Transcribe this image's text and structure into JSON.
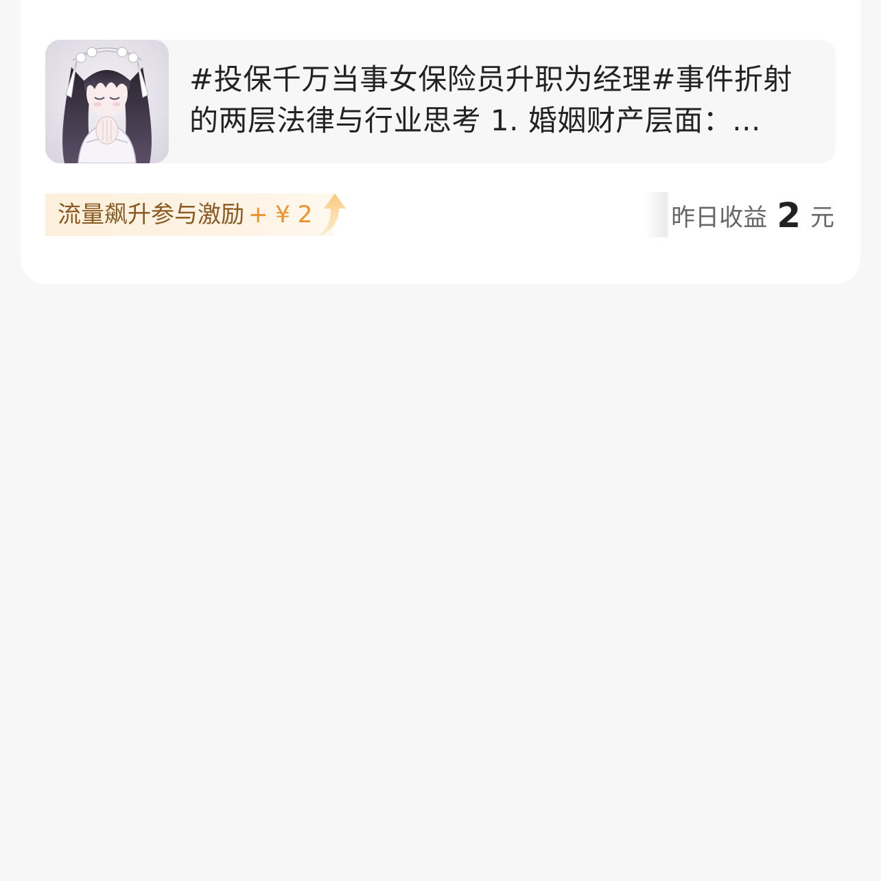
{
  "article": {
    "title": "#投保千万当事女保险员升职为经理#事件折射的两层法律与行业思考 1. 婚姻财产层面：...",
    "thumbnail_icon": "anime-girl-avatar"
  },
  "boost_tag": {
    "label": "流量飙升参与激励",
    "amount": "+ ¥ 2",
    "icon": "up-arrow-icon"
  },
  "earnings": {
    "label": "昨日收益",
    "value": "2",
    "unit": "元"
  },
  "colors": {
    "page_bg": "#f7f7f7",
    "card_bg": "#ffffff",
    "boost_text": "#8a5a22",
    "boost_amount": "#f0902a",
    "boost_bg": "#fdf0db"
  }
}
